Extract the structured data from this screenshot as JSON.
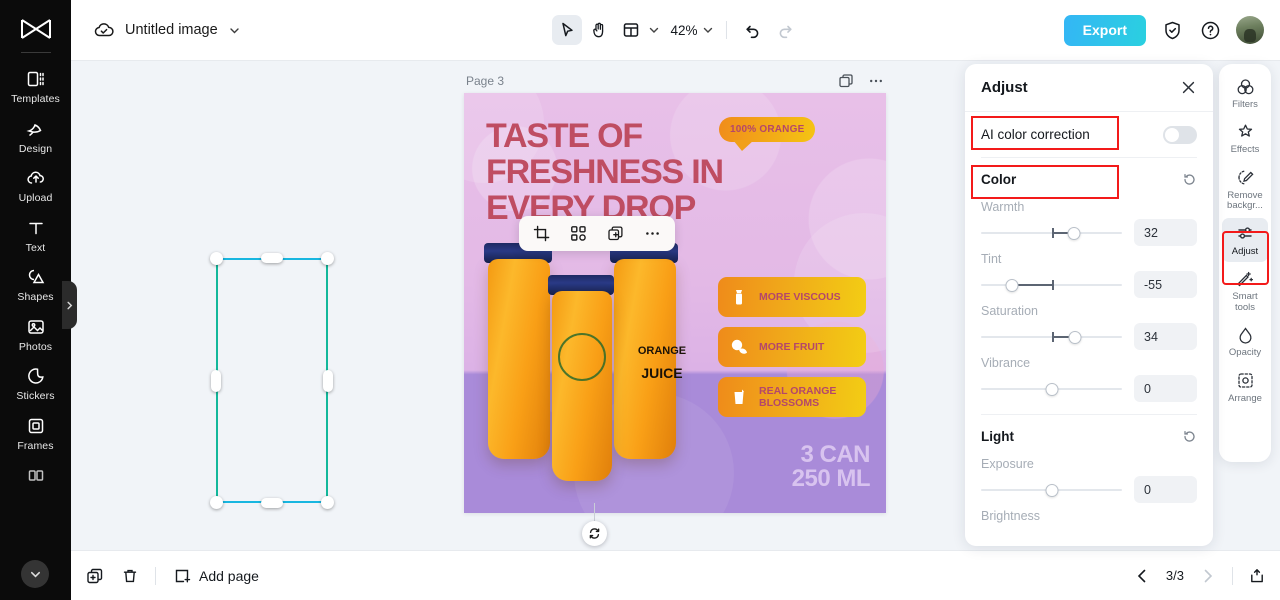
{
  "sidebar": {
    "logo": "capcut-logo",
    "items": [
      {
        "label": "Templates",
        "icon": "templates-icon"
      },
      {
        "label": "Design",
        "icon": "design-icon"
      },
      {
        "label": "Upload",
        "icon": "upload-icon"
      },
      {
        "label": "Text",
        "icon": "text-icon"
      },
      {
        "label": "Shapes",
        "icon": "shapes-icon"
      },
      {
        "label": "Photos",
        "icon": "photos-icon"
      },
      {
        "label": "Stickers",
        "icon": "stickers-icon"
      },
      {
        "label": "Frames",
        "icon": "frames-icon"
      }
    ],
    "collapse_icon": "chevron-right-icon",
    "scroll_more_icon": "chevron-down-icon"
  },
  "topbar": {
    "cloud_icon": "cloud-saved-icon",
    "doc_title": "Untitled image",
    "title_chevron": "chevron-down-icon",
    "tools": [
      {
        "name": "select-tool",
        "icon": "cursor-arrow-icon",
        "active": true
      },
      {
        "name": "hand-tool",
        "icon": "hand-icon",
        "active": false
      },
      {
        "name": "layout-tool",
        "icon": "layout-icon",
        "active": false
      }
    ],
    "zoom_value": "42%",
    "undo_icon": "undo-icon",
    "redo_icon": "redo-icon",
    "export_label": "Export",
    "shield_icon": "shield-check-icon",
    "help_icon": "help-circle-icon",
    "avatar": "user-avatar"
  },
  "canvas": {
    "page_label": "Page 3",
    "duplicate_icon": "duplicate-page-icon",
    "more_icon": "more-options-icon",
    "float_toolbar": [
      {
        "name": "crop-tool",
        "icon": "crop-icon"
      },
      {
        "name": "ungroup-tool",
        "icon": "ungroup-icon"
      },
      {
        "name": "duplicate-tool",
        "icon": "duplicate-icon"
      },
      {
        "name": "more-tool",
        "icon": "more-options-icon"
      }
    ],
    "rotate_icon": "rotate-icon",
    "design": {
      "headline_lines": [
        "TASTE OF",
        "FRESHNESS IN",
        "EVERY DROP"
      ],
      "bubble_text": "100% ORANGE",
      "badges": [
        {
          "label": "MORE VISCOUS",
          "icon": "juice-carton-icon"
        },
        {
          "label": "MORE FRUIT",
          "icon": "fruit-icon"
        },
        {
          "label": "REAL ORANGE BLOSSOMS",
          "icon": "juice-glass-icon"
        }
      ],
      "footer_lines": [
        "3 CAN",
        "250 ML"
      ],
      "bottle_label_top": "ORANGE",
      "bottle_label_bottom": "JUICE"
    }
  },
  "panel": {
    "title": "Adjust",
    "close_icon": "close-icon",
    "ai_color_correction": {
      "label": "AI color correction",
      "enabled": false
    },
    "sections": [
      {
        "title": "Color",
        "reset_icon": "reset-icon",
        "controls": [
          {
            "label": "Warmth",
            "value": "32",
            "pct": 66
          },
          {
            "label": "Tint",
            "value": "-55",
            "pct": 22
          },
          {
            "label": "Saturation",
            "value": "34",
            "pct": 67
          },
          {
            "label": "Vibrance",
            "value": "0",
            "pct": 50
          }
        ]
      },
      {
        "title": "Light",
        "reset_icon": "reset-icon",
        "controls": [
          {
            "label": "Exposure",
            "value": "0",
            "pct": 50
          },
          {
            "label": "Brightness",
            "value": "",
            "pct": 50
          }
        ]
      }
    ]
  },
  "rail": {
    "items": [
      {
        "label": "Filters",
        "icon": "filters-icon",
        "active": false
      },
      {
        "label": "Effects",
        "icon": "effects-icon",
        "active": false
      },
      {
        "label": "Remove backgr...",
        "icon": "remove-background-icon",
        "active": false
      },
      {
        "label": "Adjust",
        "icon": "adjust-icon",
        "active": true
      },
      {
        "label": "Smart tools",
        "icon": "smart-tools-icon",
        "active": false
      },
      {
        "label": "Opacity",
        "icon": "opacity-icon",
        "active": false
      },
      {
        "label": "Arrange",
        "icon": "arrange-icon",
        "active": false
      }
    ]
  },
  "bottombar": {
    "duplicate_icon": "duplicate-page-icon",
    "delete_icon": "trash-icon",
    "add_page_label": "Add page",
    "add_page_icon": "add-page-icon",
    "prev_icon": "chevron-left-icon",
    "page_count": "3/3",
    "next_icon": "chevron-right-icon",
    "export_page_icon": "export-page-icon"
  },
  "colors": {
    "accent": "#2ac4e8",
    "annotation": "#f31a1a",
    "selection": "#18b6e0",
    "guide": "#13b89b"
  }
}
